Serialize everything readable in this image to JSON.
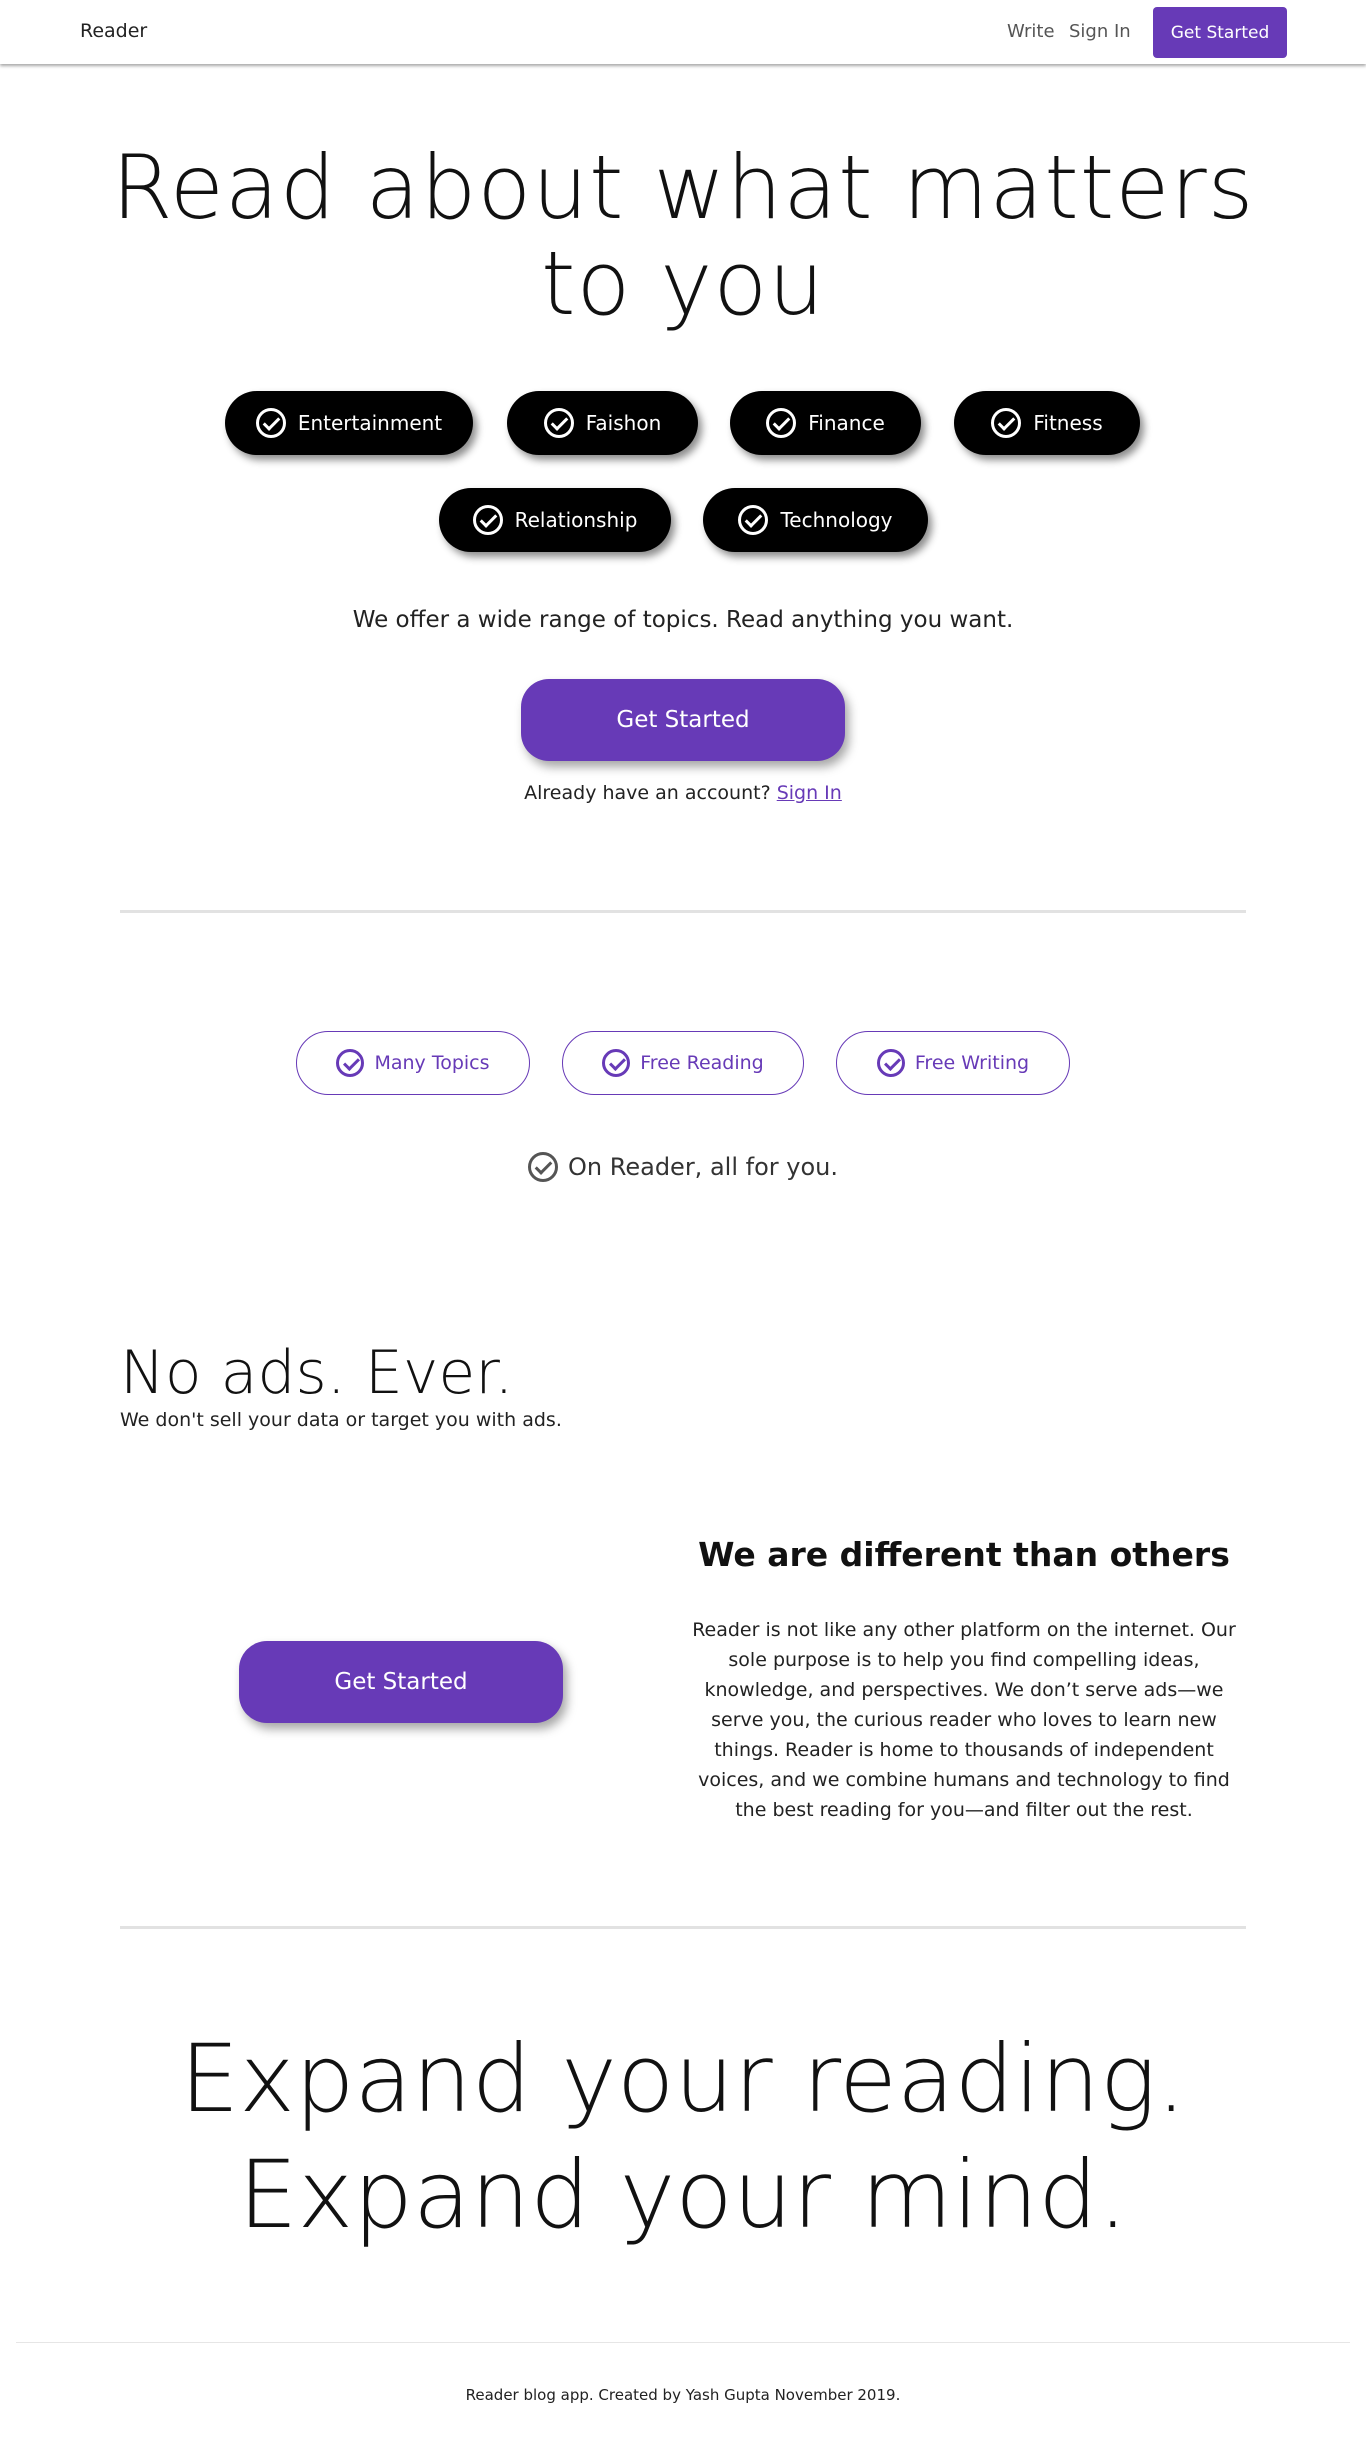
{
  "nav": {
    "brand": "Reader",
    "write": "Write",
    "sign_in": "Sign In",
    "cta": "Get Started"
  },
  "hero": {
    "title_line1": "Read about what matters",
    "title_line2": "to you",
    "topics": [
      "Entertainment",
      "Faishon",
      "Finance",
      "Fitness",
      "Relationship",
      "Technology"
    ],
    "lead": "We offer a wide range of topics. Read anything you want.",
    "cta": "Get Started",
    "account_prompt": "Already have an account?",
    "sign_in_link": "Sign In"
  },
  "features": {
    "chips": [
      "Many Topics",
      "Free Reading",
      "Free Writing"
    ],
    "tagline": "On Reader, all for you."
  },
  "no_ads": {
    "title": "No ads. Ever.",
    "subtitle": "We don't sell your data or target you with ads."
  },
  "different": {
    "cta": "Get Started",
    "title": "We are different than others",
    "body": "Reader is not like any other platform on the internet. Our sole purpose is to help you find compelling ideas, knowledge, and perspectives. We don’t serve ads—we serve you, the curious reader who loves to learn new things. Reader is home to thousands of independent voices, and we combine humans and technology to find the best reading for you—and filter out the rest."
  },
  "closing": {
    "line1": "Expand your reading.",
    "line2": "Expand your mind."
  },
  "footer": {
    "text": "Reader blog app. Created by Yash Gupta November 2019."
  },
  "colors": {
    "accent": "#673ab7",
    "chip_dark": "#000000"
  },
  "icons": {
    "topic_chip": "check-circle-icon"
  }
}
